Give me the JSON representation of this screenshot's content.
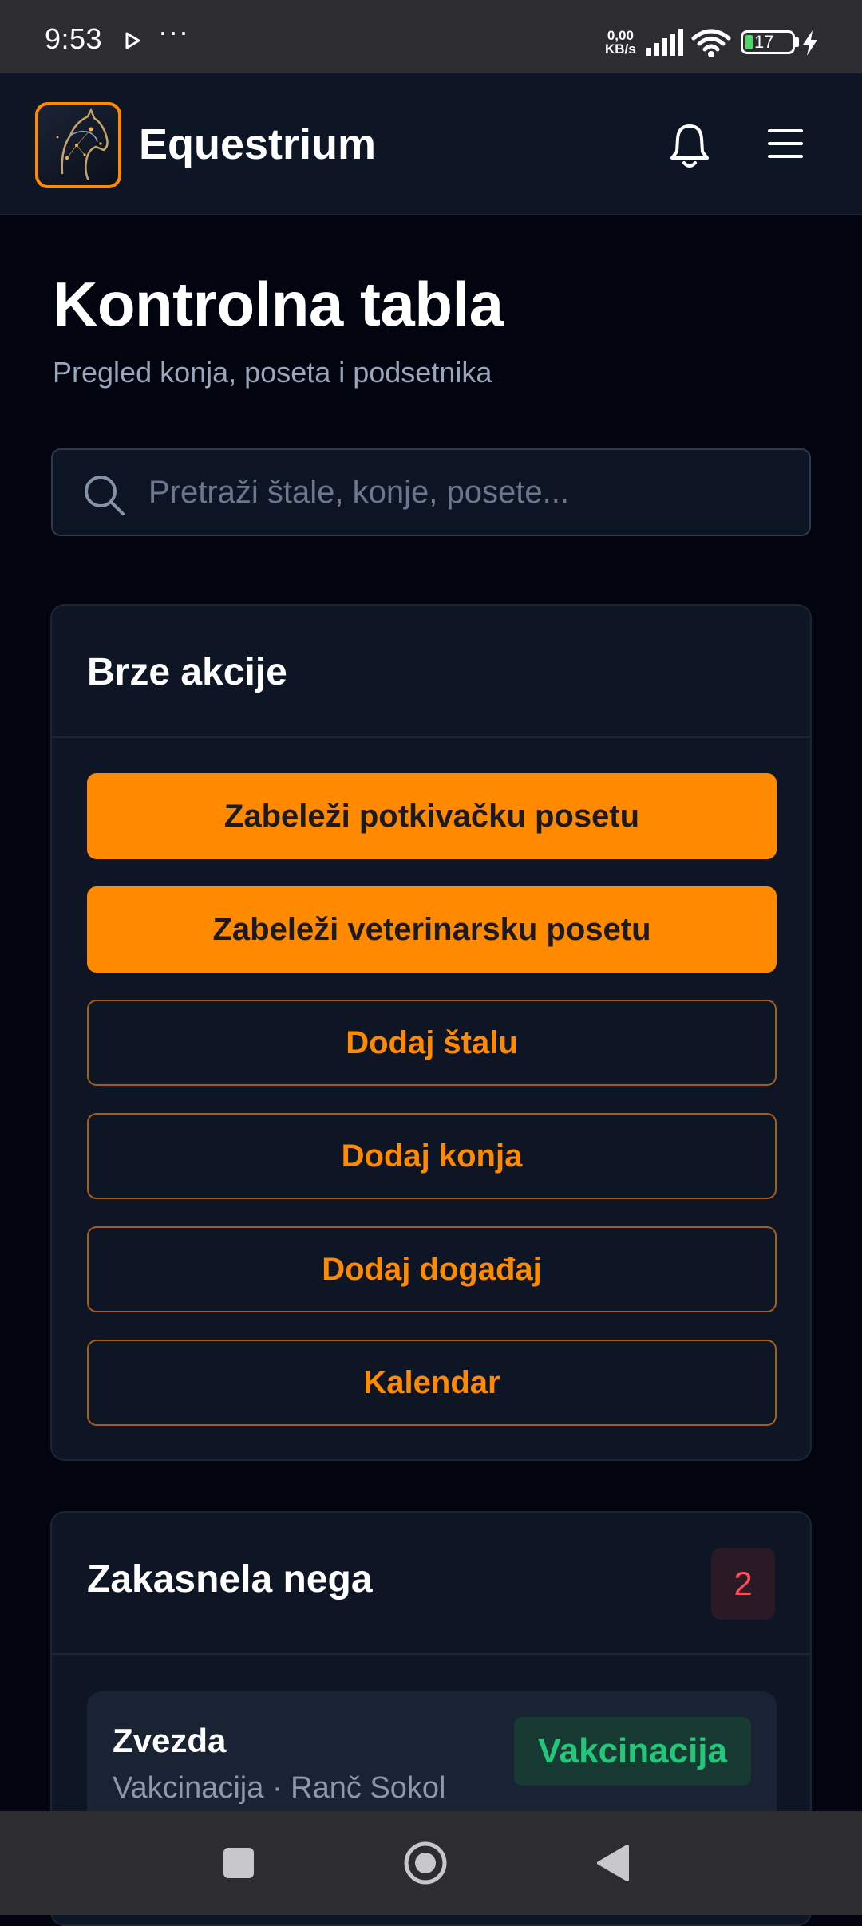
{
  "status_bar": {
    "time": "9:53",
    "dots": "···",
    "speed_top": "0,00",
    "speed_bottom": "KB/s",
    "battery": "17"
  },
  "app": {
    "title": "Equestrium",
    "accent": "#ff8a00"
  },
  "page": {
    "title": "Kontrolna tabla",
    "subtitle": "Pregled konja, poseta i podsetnika"
  },
  "search": {
    "placeholder": "Pretraži štale, konje, posete..."
  },
  "quick_actions": {
    "title": "Brze akcije",
    "buttons": [
      {
        "label": "Zabeleži potkivačku posetu",
        "style": "solid"
      },
      {
        "label": "Zabeleži veterinarsku posetu",
        "style": "solid"
      },
      {
        "label": "Dodaj štalu",
        "style": "outline"
      },
      {
        "label": "Dodaj konja",
        "style": "outline"
      },
      {
        "label": "Dodaj događaj",
        "style": "outline"
      },
      {
        "label": "Kalendar",
        "style": "outline"
      }
    ]
  },
  "overdue": {
    "title": "Zakasnela nega",
    "count": "2",
    "items": [
      {
        "name": "Zvezda",
        "meta": "Vakcinacija · Ranč Sokol",
        "badge": "Vakcinacija"
      }
    ]
  },
  "icons": {
    "notifications": "bell-icon",
    "menu": "hamburger-menu-icon",
    "search": "search-icon",
    "logo": "horse-head-logo"
  }
}
